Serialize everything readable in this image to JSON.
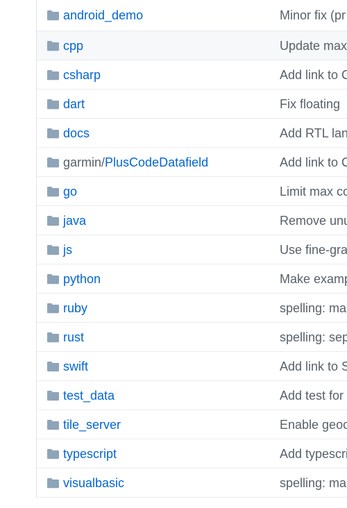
{
  "icon": "folder-icon",
  "colors": {
    "link": "#0366d6",
    "muted": "#586069",
    "folder": "#79b8ff",
    "border": "#eaecef"
  },
  "rows": [
    {
      "name": "android_demo",
      "prefix": "",
      "commit": "Minor fix (pr"
    },
    {
      "name": "cpp",
      "prefix": "",
      "commit": "Update max"
    },
    {
      "name": "csharp",
      "prefix": "",
      "commit": "Add link to C"
    },
    {
      "name": "dart",
      "prefix": "",
      "commit": "Fix floating"
    },
    {
      "name": "docs",
      "prefix": "",
      "commit": "Add RTL lan"
    },
    {
      "name": "PlusCodeDatafield",
      "prefix": "garmin/",
      "commit": "Add link to C"
    },
    {
      "name": "go",
      "prefix": "",
      "commit": "Limit max co"
    },
    {
      "name": "java",
      "prefix": "",
      "commit": "Remove unu"
    },
    {
      "name": "js",
      "prefix": "",
      "commit": "Use fine-gra"
    },
    {
      "name": "python",
      "prefix": "",
      "commit": "Make examp"
    },
    {
      "name": "ruby",
      "prefix": "",
      "commit": "spelling: ma"
    },
    {
      "name": "rust",
      "prefix": "",
      "commit": "spelling: sep"
    },
    {
      "name": "swift",
      "prefix": "",
      "commit": "Add link to S"
    },
    {
      "name": "test_data",
      "prefix": "",
      "commit": "Add test for"
    },
    {
      "name": "tile_server",
      "prefix": "",
      "commit": "Enable geoc"
    },
    {
      "name": "typescript",
      "prefix": "",
      "commit": "Add typescri"
    },
    {
      "name": "visualbasic",
      "prefix": "",
      "commit": "spelling: ma"
    }
  ]
}
